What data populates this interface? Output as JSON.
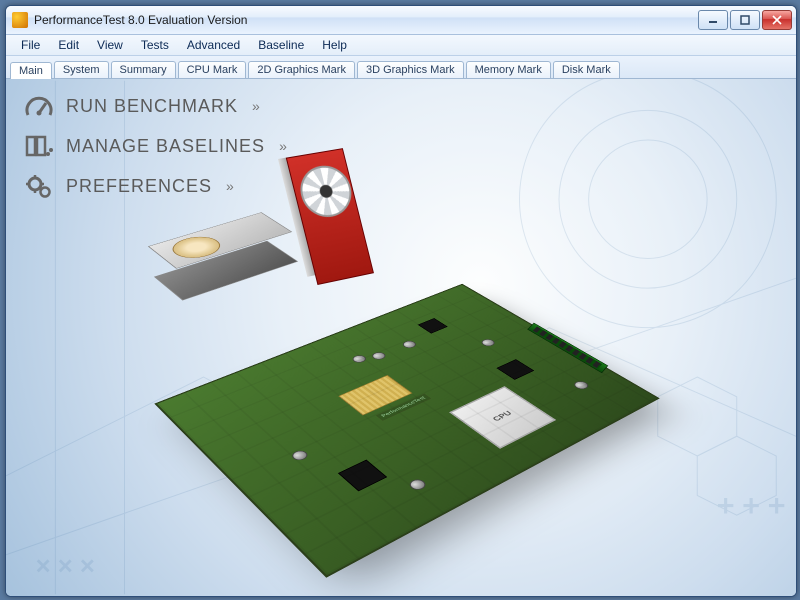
{
  "window": {
    "title": "PerformanceTest 8.0 Evaluation Version"
  },
  "menu": {
    "items": [
      "File",
      "Edit",
      "View",
      "Tests",
      "Advanced",
      "Baseline",
      "Help"
    ]
  },
  "tabs": {
    "items": [
      "Main",
      "System",
      "Summary",
      "CPU Mark",
      "2D Graphics Mark",
      "3D Graphics Mark",
      "Memory Mark",
      "Disk Mark"
    ],
    "active_index": 0
  },
  "main_links": [
    {
      "icon": "gauge-icon",
      "label": "RUN BENCHMARK"
    },
    {
      "icon": "archive-icon",
      "label": "MANAGE BASELINES"
    },
    {
      "icon": "gears-icon",
      "label": "PREFERENCES"
    }
  ],
  "scene": {
    "cpu_label": "CPU",
    "board_label": "PerformanceTest"
  },
  "glyphs": {
    "chevron": "»"
  }
}
